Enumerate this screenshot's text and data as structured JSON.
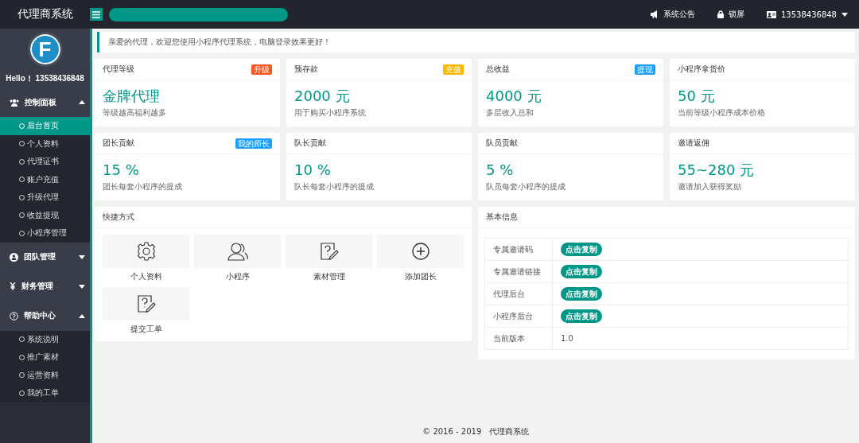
{
  "header": {
    "title": "代理商系统",
    "actions": [
      {
        "kind": "notice",
        "label": "系统公告"
      },
      {
        "kind": "lock",
        "label": "锁屏"
      },
      {
        "kind": "user",
        "label": "13538436848"
      }
    ]
  },
  "sidebar": {
    "avatar_letter": "F",
    "greeting": "Hello！ 13538436848",
    "groups": [
      {
        "kind": "users",
        "label": "控制面板",
        "expanded": true,
        "children": [
          {
            "label": "后台首页",
            "selected": true
          },
          {
            "label": "个人资料",
            "selected": false
          },
          {
            "label": "代理证书",
            "selected": false
          },
          {
            "label": "账户充值",
            "selected": false
          },
          {
            "label": "升级代理",
            "selected": false
          },
          {
            "label": "收益提现",
            "selected": false
          },
          {
            "label": "小程序管理",
            "selected": false
          }
        ]
      },
      {
        "kind": "team",
        "label": "团队管理",
        "expanded": false
      },
      {
        "kind": "yen",
        "label": "财务管理",
        "expanded": false
      },
      {
        "kind": "help",
        "label": "帮助中心",
        "expanded": true,
        "children": [
          {
            "label": "系统说明",
            "selected": false
          },
          {
            "label": "推广素材",
            "selected": false
          },
          {
            "label": "运营资料",
            "selected": false
          },
          {
            "label": "我的工单",
            "selected": false
          }
        ]
      }
    ]
  },
  "welcome": "亲爱的代理，欢迎您使用小程序代理系统，电脑登录效果更好！",
  "stats": [
    {
      "title": "代理等级",
      "badge": {
        "label": "升级",
        "color": "#ff5722"
      },
      "value": "金牌代理",
      "desc": "等级越高福利越多"
    },
    {
      "title": "预存款",
      "badge": {
        "label": "充值",
        "color": "#ffb800"
      },
      "value": "2000 元",
      "desc": "用于购买小程序系统"
    },
    {
      "title": "总收益",
      "badge": {
        "label": "提现",
        "color": "#1e9fff"
      },
      "value": "4000 元",
      "desc": "多层收入总和"
    },
    {
      "title": "小程序拿货价",
      "value": "50 元",
      "desc": "当前等级小程序成本价格"
    },
    {
      "title": "团长贡献",
      "badge": {
        "label": "我的师长",
        "color": "#1e9fff"
      },
      "value": "15 %",
      "desc": "团长每套小程序的提成"
    },
    {
      "title": "队长贡献",
      "value": "10 %",
      "desc": "队长每套小程序的提成"
    },
    {
      "title": "队员贡献",
      "value": "5 %",
      "desc": "队员每套小程序的提成"
    },
    {
      "title": "邀请返佣",
      "value": "55~280 元",
      "desc": "邀请加入获得奖励"
    }
  ],
  "shortcuts": {
    "title": "快捷方式",
    "items": [
      {
        "kind": "gear",
        "label": "个人资料"
      },
      {
        "kind": "people",
        "label": "小程序"
      },
      {
        "kind": "note",
        "label": "素材管理"
      },
      {
        "kind": "plus",
        "label": "添加团长"
      },
      {
        "kind": "note",
        "label": "提交工单"
      }
    ]
  },
  "info": {
    "title": "基本信息",
    "rows": [
      {
        "label": "专属邀请码",
        "kind": "button",
        "value": "点击复制"
      },
      {
        "label": "专属邀请链接",
        "kind": "button",
        "value": "点击复制"
      },
      {
        "label": "代理后台",
        "kind": "button",
        "value": "点击复制"
      },
      {
        "label": "小程序后台",
        "kind": "button",
        "value": "点击复制"
      },
      {
        "label": "当前版本",
        "kind": "text",
        "value": "1.0"
      }
    ]
  },
  "footer": "© 2016 - 2019   代理商系统"
}
